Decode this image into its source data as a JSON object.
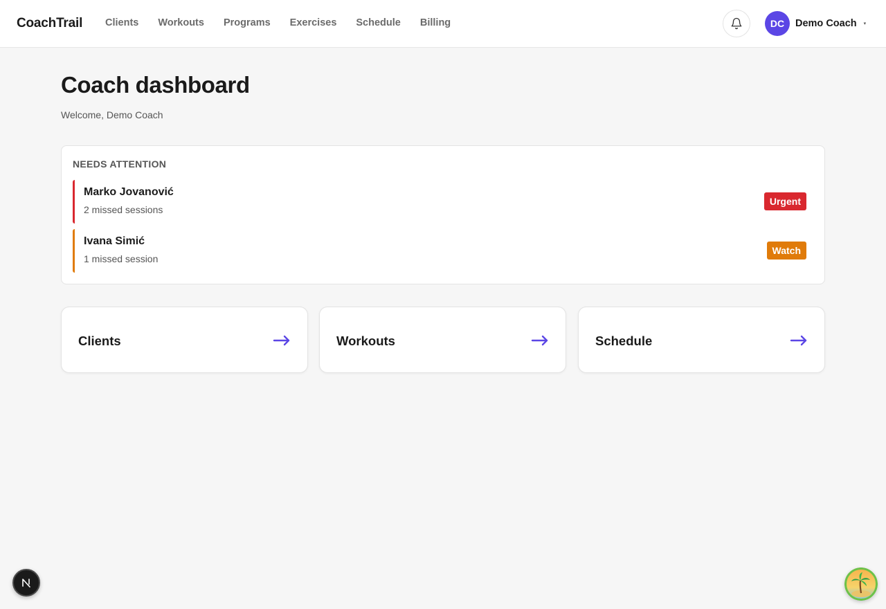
{
  "brand": "CoachTrail",
  "nav": [
    "Clients",
    "Workouts",
    "Programs",
    "Exercises",
    "Schedule",
    "Billing"
  ],
  "user": {
    "initials": "DC",
    "name": "Demo Coach",
    "caret": "▾"
  },
  "header": {
    "title": "Coach dashboard",
    "welcome": "Welcome, Demo Coach"
  },
  "attention": {
    "title": "NEEDS ATTENTION",
    "items": [
      {
        "name": "Marko Jovanović",
        "detail": "2 missed sessions",
        "badge": "Urgent",
        "color": "#d9282f"
      },
      {
        "name": "Ivana Simić",
        "detail": "1 missed session",
        "badge": "Watch",
        "color": "#e07b0a"
      }
    ]
  },
  "quick_links": [
    "Clients",
    "Workouts",
    "Schedule"
  ],
  "icons": {
    "bell": "bell-icon",
    "arrow": "arrow-right-icon",
    "next": "nextjs-logo-icon",
    "palm": "palm-tree-icon"
  },
  "colors": {
    "accent": "#5b46e5",
    "urgent": "#d9282f",
    "watch": "#e07b0a"
  }
}
